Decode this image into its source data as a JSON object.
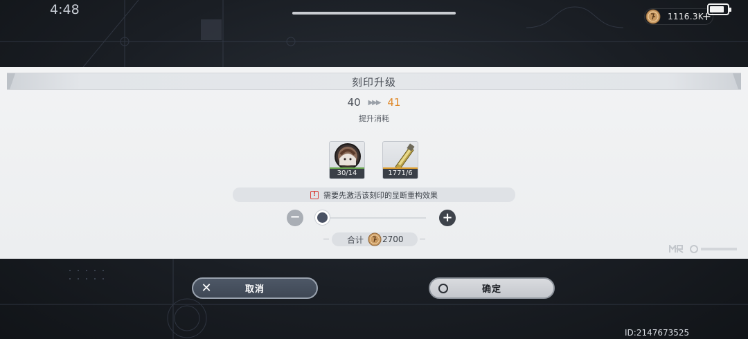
{
  "status_bar": {
    "time": "4:48",
    "currency_amount": "1116.3K",
    "currency_plus": "+"
  },
  "dialog": {
    "title": "刻印升级",
    "level_from": "40",
    "level_arrows": "▶▶▶",
    "level_to": "41",
    "cost_label": "提升消耗",
    "items": [
      {
        "icon": "character-portrait-icon",
        "quantity": "30/14",
        "rarity_color": "#6aa84f"
      },
      {
        "icon": "gold-material-icon",
        "quantity": "1771/6",
        "rarity_color": "#e0a030"
      }
    ],
    "warning_icon": "!",
    "warning_text": "需要先激活该刻印的显断重构效果",
    "stepper": {
      "minus": "−",
      "plus": "+",
      "level": 0
    },
    "total_label": "合计",
    "total_amount": "2700"
  },
  "buttons": {
    "cancel_icon": "✕",
    "cancel_label": "取消",
    "confirm_label": "确定"
  },
  "uid": "ID:2147673525",
  "colors": {
    "accent_orange": "#e08a2c",
    "dialog_bg": "#f2f3f4",
    "dark_button": "#3f4855"
  }
}
